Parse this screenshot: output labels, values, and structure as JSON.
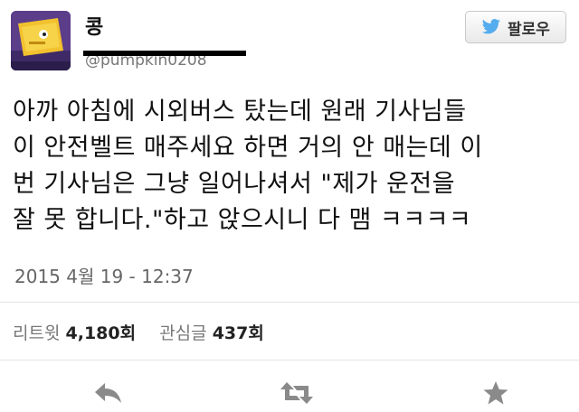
{
  "user": {
    "display_name": "콩",
    "handle": "@pumpkin0208"
  },
  "follow_button": {
    "label": "팔로우",
    "icon": "twitter-bird-icon"
  },
  "tweet": {
    "lines": [
      "아까 아침에 시외버스 탔는데 원래 기사님들",
      "이 안전벨트 매주세요 하면 거의 안 매는데 이",
      "번 기사님은 그냥 일어나셔서 \"제가 운전을",
      "잘 못 합니다.\"하고 앉으시니 다 맴 ㅋㅋㅋㅋ"
    ],
    "timestamp": "2015 4월 19 - 12:37"
  },
  "stats": {
    "retweets_label": "리트윗",
    "retweets_value": "4,180회",
    "favorites_label": "관심글",
    "favorites_value": "437회"
  },
  "actions": {
    "reply_icon": "reply-icon",
    "retweet_icon": "retweet-icon",
    "favorite_icon": "star-icon"
  },
  "colors": {
    "twitter_blue": "#55acee",
    "action_gray": "#8a8a8a",
    "avatar_bg": "#5b3d8a",
    "avatar_accent": "#f2c12e"
  }
}
